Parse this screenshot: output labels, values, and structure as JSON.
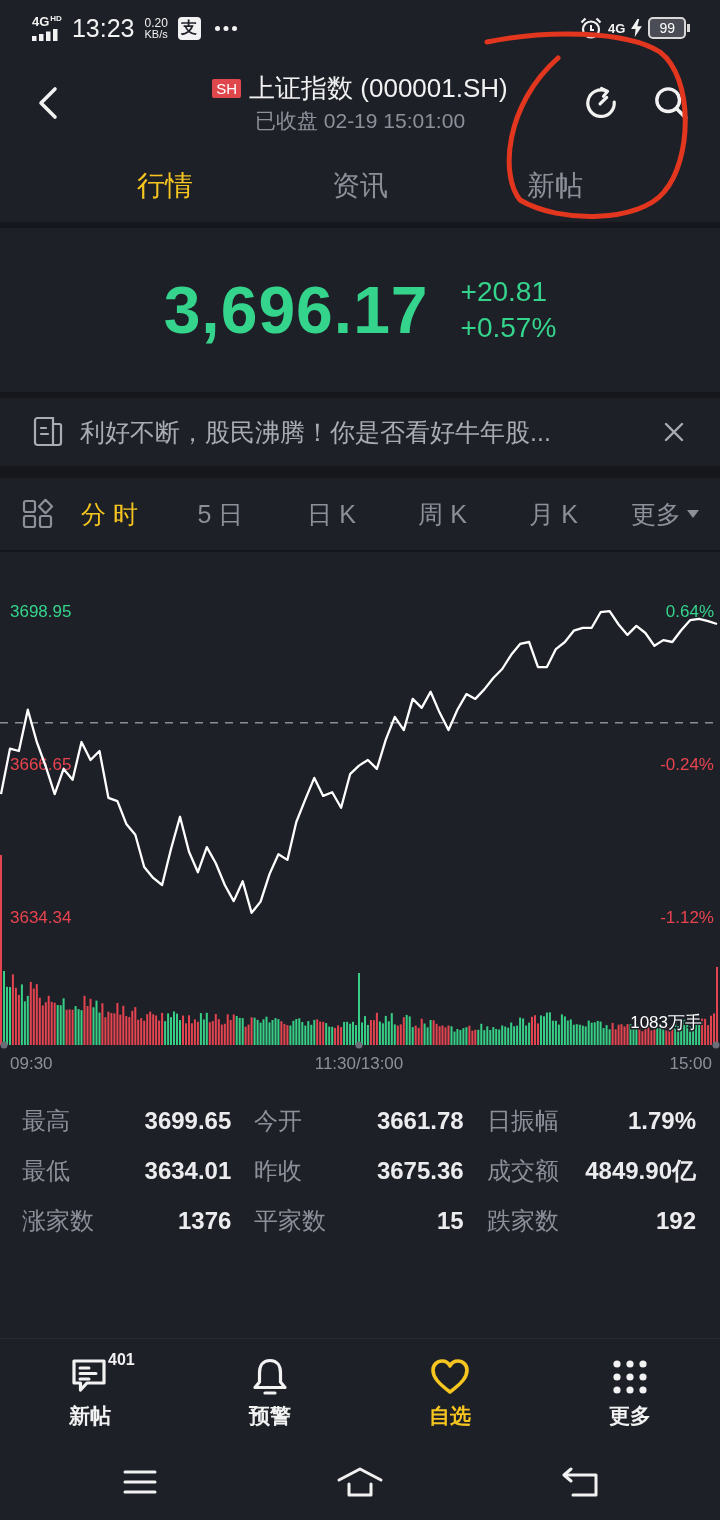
{
  "status_bar": {
    "network": "4G",
    "network_badge": "HD",
    "time": "13:23",
    "speed": "0.20",
    "speed_unit": "KB/s",
    "app_icon_glyph": "支",
    "network_right": "4G",
    "battery": "99"
  },
  "header": {
    "badge": "SH",
    "title": "上证指数 (000001.SH)",
    "subtitle": "已收盘 02-19 15:01:00"
  },
  "tabs": [
    {
      "label": "行情",
      "selected": true
    },
    {
      "label": "资讯",
      "selected": false
    },
    {
      "label": "新帖",
      "selected": false
    }
  ],
  "quote": {
    "price": "3,696.17",
    "change": "+20.81",
    "change_percent": "+0.57%"
  },
  "banner": {
    "text": "利好不断，股民沸腾！你是否看好牛年股..."
  },
  "chart_tabs": [
    {
      "label": "分 时",
      "kind": "period",
      "selected": true
    },
    {
      "label": "5 日",
      "kind": "period",
      "selected": false
    },
    {
      "label": "日 K",
      "kind": "period",
      "selected": false
    },
    {
      "label": "周 K",
      "kind": "period",
      "selected": false
    },
    {
      "label": "月 K",
      "kind": "period",
      "selected": false
    },
    {
      "label": "更多",
      "kind": "dropdown",
      "selected": false
    }
  ],
  "chart": {
    "percent_labels": [
      "0.64%",
      "-0.24%",
      "-1.12%"
    ],
    "volume_label": "1083万手",
    "time_labels": [
      "09:30",
      "11:30/13:00",
      "15:00"
    ],
    "chart_data": {
      "type": "line",
      "values": [
        3660.3,
        3669.9,
        3669.4,
        3678.1,
        3671.3,
        3666.1,
        3660.3,
        3665.6,
        3663.3,
        3671.3,
        3667.5,
        3669.4,
        3659.5,
        3658.8,
        3654,
        3651.7,
        3644.9,
        3642.6,
        3641.1,
        3648.7,
        3655.5,
        3648.1,
        3643.8,
        3649.1,
        3645.7,
        3641.1,
        3637.7,
        3641.9,
        3635.2,
        3637.6,
        3643.4,
        3647.6,
        3646.4,
        3654.4,
        3659.2,
        3663.7,
        3659.9,
        3660.7,
        3657.4,
        3664.5,
        3666.3,
        3667.5,
        3665.6,
        3671.8,
        3676.6,
        3673.8,
        3680.4,
        3678.5,
        3681.9,
        3677.5,
        3673.8,
        3678.1,
        3681.4,
        3680.4,
        3682.4,
        3684.8,
        3686.7,
        3689.7,
        3692,
        3692.4,
        3687.1,
        3687.1,
        3690.9,
        3692.4,
        3694.8,
        3695.4,
        3695.4,
        3698.7,
        3698.9,
        3696.1,
        3693.9,
        3695.8,
        3694.3,
        3691.6,
        3692.8,
        3692.4,
        3694.9,
        3697,
        3697.3,
        3696.8,
        3696.2
      ],
      "ylim": [
        3634.34,
        3698.95
      ],
      "yticks": [
        3698.95,
        3666.65,
        3634.34
      ],
      "ref_lines": [
        {
          "axis": "y",
          "value": 3675.36
        }
      ]
    }
  },
  "stats": [
    {
      "label": "最高",
      "value": "3699.65"
    },
    {
      "label": "今开",
      "value": "3661.78"
    },
    {
      "label": "日振幅",
      "value": "1.79%"
    },
    {
      "label": "最低",
      "value": "3634.01"
    },
    {
      "label": "昨收",
      "value": "3675.36"
    },
    {
      "label": "成交额",
      "value": "4849.90亿"
    },
    {
      "label": "涨家数",
      "value": "1376"
    },
    {
      "label": "平家数",
      "value": "15"
    },
    {
      "label": "跌家数",
      "value": "192"
    }
  ],
  "bottom_nav": [
    {
      "label": "新帖",
      "kind": "posts",
      "badge": "401",
      "selected": false
    },
    {
      "label": "预警",
      "kind": "alerts",
      "selected": false
    },
    {
      "label": "自选",
      "kind": "watchlist",
      "selected": true
    },
    {
      "label": "更多",
      "kind": "more",
      "selected": false
    }
  ],
  "annotation": {
    "kind": "circle"
  }
}
